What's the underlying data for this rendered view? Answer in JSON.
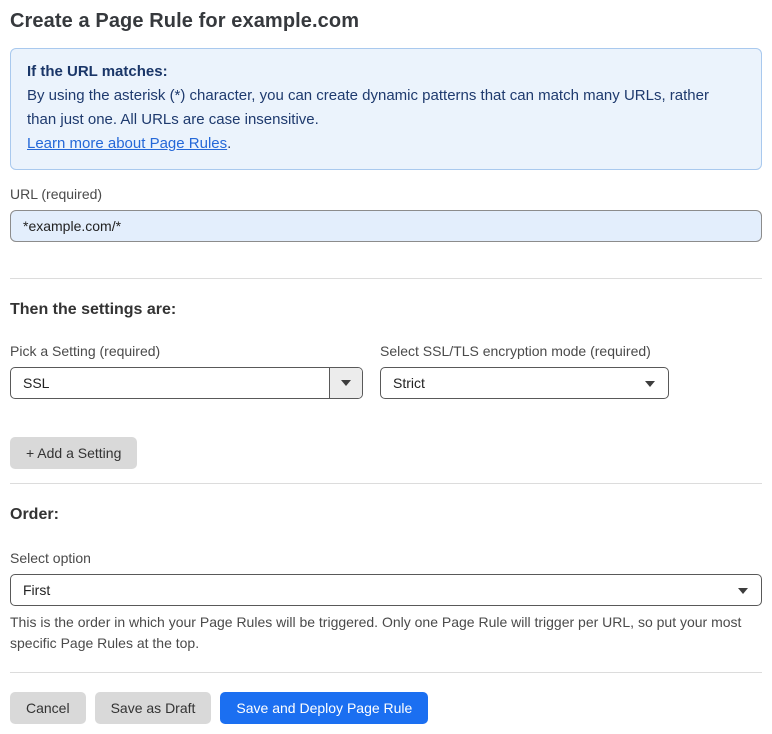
{
  "page": {
    "title": "Create a Page Rule for example.com"
  },
  "info_box": {
    "heading": "If the URL matches:",
    "body": "By using the asterisk (*) character, you can create dynamic patterns that can match many URLs, rather than just one. All URLs are case insensitive.",
    "link_label": "Learn more about Page Rules",
    "link_suffix": "."
  },
  "url_field": {
    "label": "URL (required)",
    "value": "*example.com/*"
  },
  "settings_section": {
    "heading": "Then the settings are:",
    "setting_field": {
      "label": "Pick a Setting (required)",
      "value": "SSL"
    },
    "mode_field": {
      "label": "Select SSL/TLS encryption mode (required)",
      "value": "Strict"
    },
    "add_setting_label": "+ Add a Setting"
  },
  "order_section": {
    "heading": "Order:",
    "label": "Select option",
    "value": "First",
    "help_text": "This is the order in which your Page Rules will be triggered. Only one Page Rule will trigger per URL, so put your most specific Page Rules at the top."
  },
  "footer": {
    "cancel_label": "Cancel",
    "save_draft_label": "Save as Draft",
    "save_deploy_label": "Save and Deploy Page Rule"
  },
  "colors": {
    "accent_blue": "#1b6ff1",
    "info_background": "#ebf3fc",
    "info_border": "#a9c9ee",
    "info_text": "#1e3a6e",
    "link_blue": "#2468d8",
    "input_background": "#e3eefc",
    "button_gray": "#d9d9d9"
  }
}
